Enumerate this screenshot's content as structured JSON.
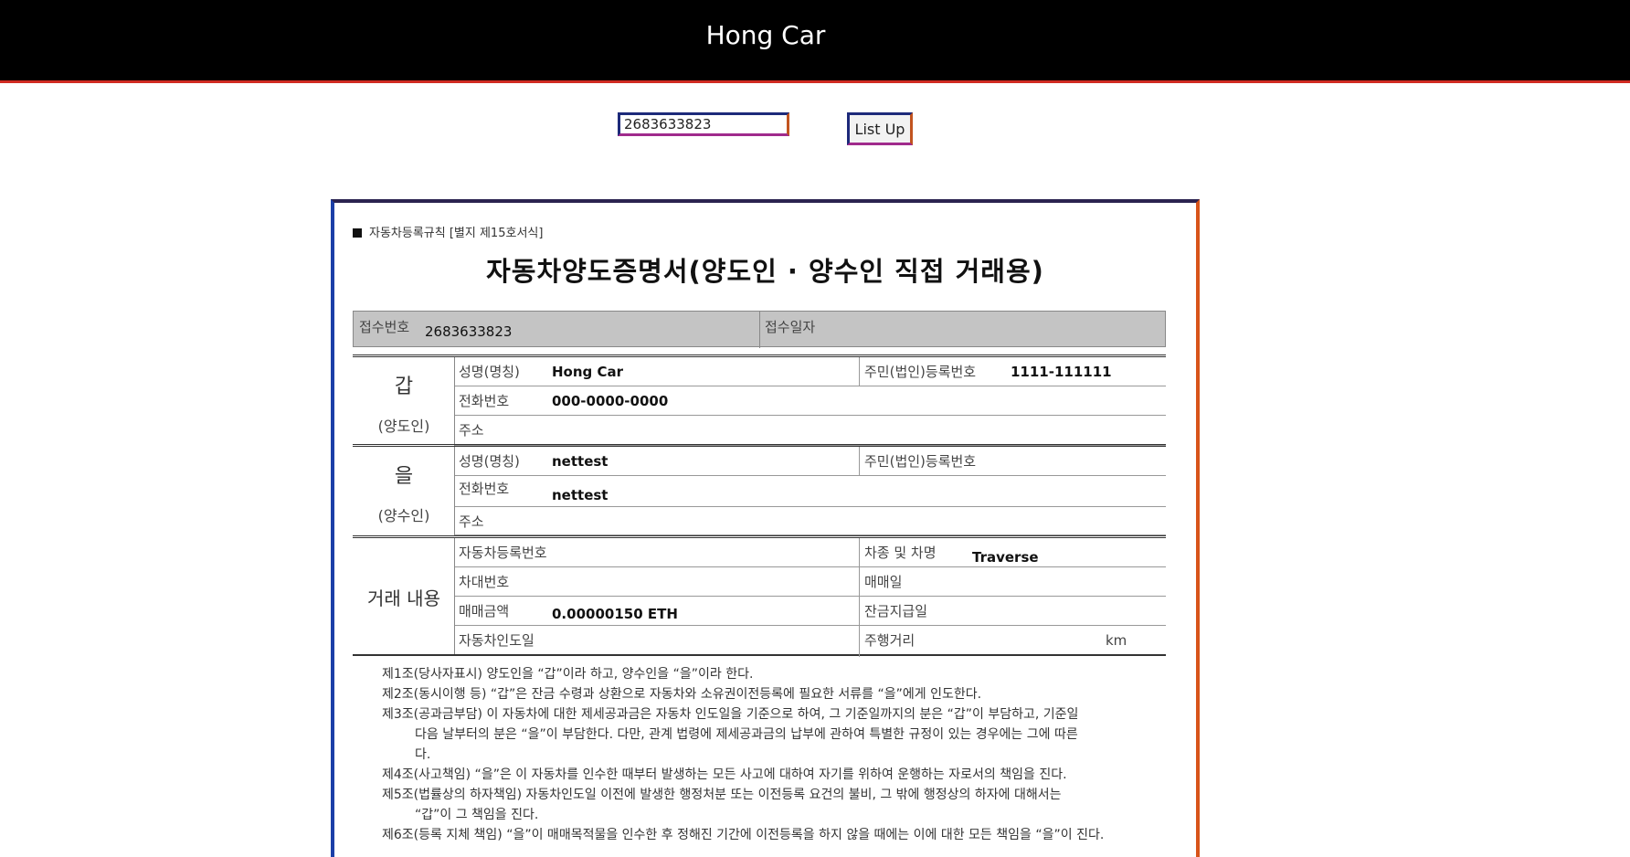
{
  "header": {
    "title": "Hong Car"
  },
  "search": {
    "value": "2683633823"
  },
  "actions": {
    "list_up_label": "List Up"
  },
  "document": {
    "form_rule": "자동차등록규칙 [별지 제15호서식]",
    "title": "자동차양도증명서(양도인 · 양수인 직접 거래용)",
    "receipt": {
      "number_label": "접수번호",
      "number_value": "2683633823",
      "date_label": "접수일자"
    },
    "seller": {
      "head": "갑",
      "sub": "(양도인)",
      "name_label": "성명(명칭)",
      "name_value": "Hong Car",
      "id_label": "주민(법인)등록번호",
      "id_value": "1111-111111",
      "phone_label": "전화번호",
      "phone_value": "000-0000-0000",
      "address_label": "주소"
    },
    "buyer": {
      "head": "을",
      "sub": "(양수인)",
      "name_label": "성명(명칭)",
      "name_value": "nettest",
      "id_label": "주민(법인)등록번호",
      "phone_label": "전화번호",
      "phone_value": "nettest",
      "address_label": "주소"
    },
    "deal": {
      "head": "거래 내용",
      "reg_no_label": "자동차등록번호",
      "model_label": "차종 및 차명",
      "model_value": "Traverse",
      "vin_label": "차대번호",
      "sale_date_label": "매매일",
      "price_label": "매매금액",
      "price_value": "0.00000150 ETH",
      "balance_date_label": "잔금지급일",
      "delivery_date_label": "자동차인도일",
      "mileage_label": "주행거리",
      "mileage_unit": "km"
    },
    "clauses": [
      "제1조(당사자표시) 양도인을 “갑”이라 하고, 양수인을 “을”이라 한다.",
      "제2조(동시이행 등) “갑”은 잔금 수령과 상환으로 자동차와 소유권이전등록에 필요한 서류를 “을”에게 인도한다.",
      "제3조(공과금부담) 이 자동차에 대한 제세공과금은 자동차 인도일을 기준으로 하여, 그 기준일까지의 분은 “갑”이 부담하고, 기준일",
      "다음 날부터의 분은 “을”이 부담한다. 다만, 관계 법령에 제세공과금의 납부에 관하여 특별한 규정이 있는 경우에는 그에 따른",
      "다.",
      "제4조(사고책임) “을”은 이 자동차를 인수한 때부터 발생하는 모든 사고에 대하여 자기를 위하여 운행하는 자로서의 책임을 진다.",
      "제5조(법률상의 하자책임) 자동차인도일 이전에 발생한 행정처분 또는 이전등록 요건의 불비, 그 밖에 행정상의 하자에 대해서는",
      "“갑”이 그 책임을 진다.",
      "제6조(등록 지체 책임) “을”이 매매목적물을 인수한 후 정해진 기간에 이전등록을 하지 않을 때에는 이에 대한 모든 책임을 “을”이 진다."
    ]
  }
}
